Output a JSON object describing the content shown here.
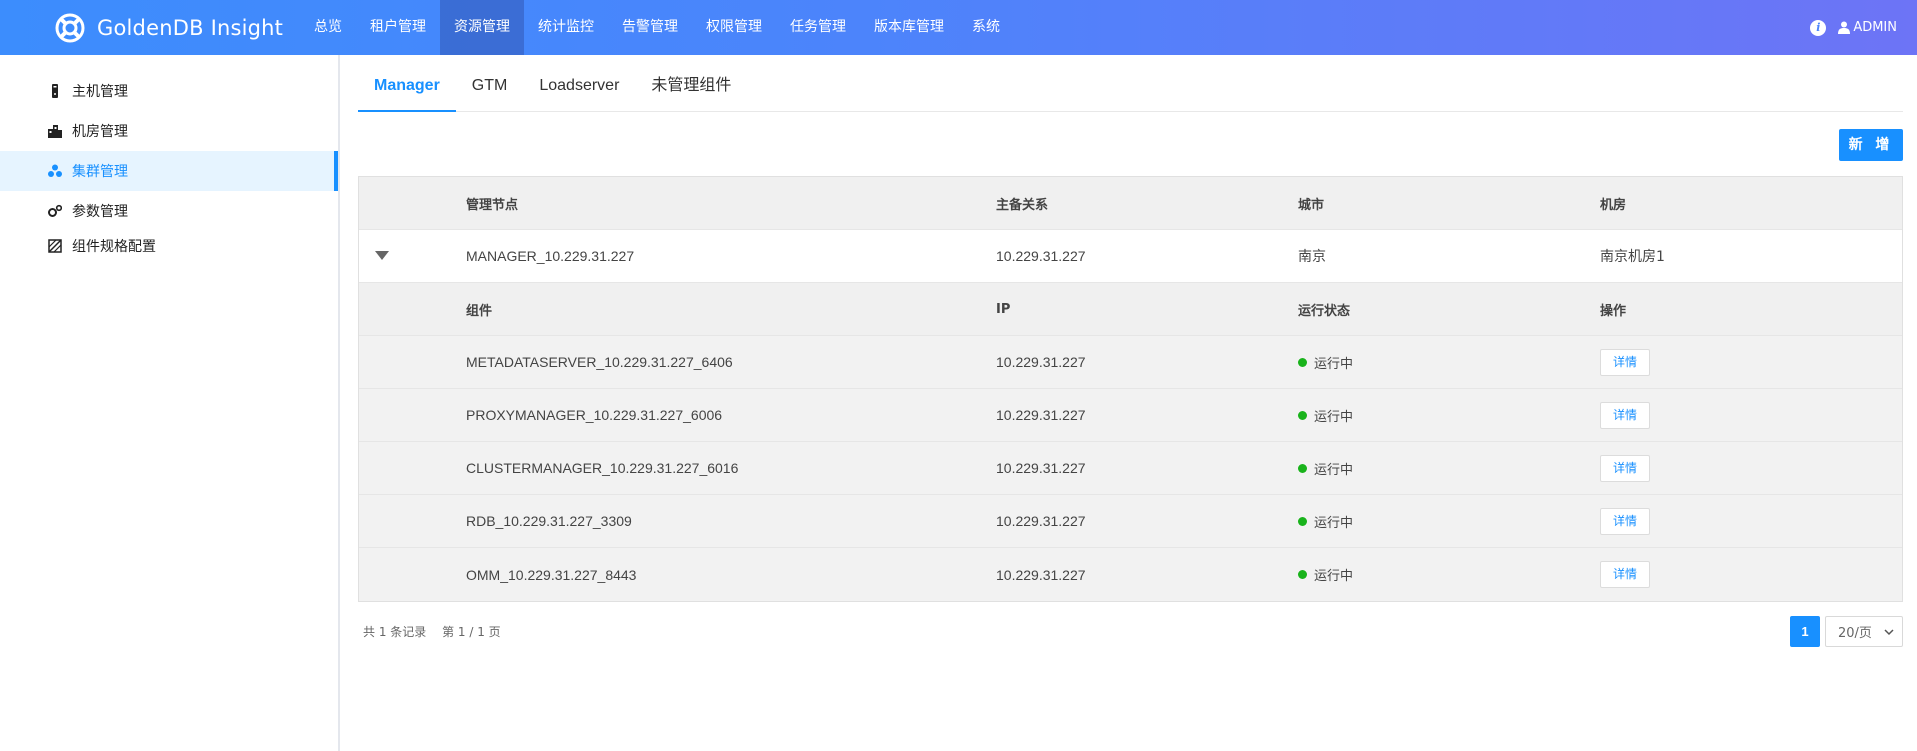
{
  "header": {
    "brand_name": "GoldenDB Insight",
    "nav": [
      {
        "label": "总览"
      },
      {
        "label": "租户管理"
      },
      {
        "label": "资源管理"
      },
      {
        "label": "统计监控"
      },
      {
        "label": "告警管理"
      },
      {
        "label": "权限管理"
      },
      {
        "label": "任务管理"
      },
      {
        "label": "版本库管理"
      },
      {
        "label": "系统"
      }
    ],
    "active_nav": "资源管理",
    "info_icon": "info-icon",
    "user_label": "ADMIN"
  },
  "sidebar": {
    "items": [
      {
        "label": "主机管理",
        "icon": "host-icon"
      },
      {
        "label": "机房管理",
        "icon": "building-icon"
      },
      {
        "label": "集群管理",
        "icon": "cluster-icon"
      },
      {
        "label": "参数管理",
        "icon": "gears-icon"
      },
      {
        "label": "组件规格配置",
        "icon": "spec-icon"
      }
    ],
    "active_item": "集群管理"
  },
  "tabs": [
    {
      "label": "Manager"
    },
    {
      "label": "GTM"
    },
    {
      "label": "Loadserver"
    },
    {
      "label": "未管理组件"
    }
  ],
  "active_tab": "Manager",
  "add_button_label": "新 增",
  "table": {
    "headers": [
      "管理节点",
      "主备关系",
      "城市",
      "机房"
    ],
    "parent_row": {
      "node": "MANAGER_10.229.31.227",
      "relation": "10.229.31.227",
      "city": "南京",
      "room": "南京机房1"
    },
    "sub_headers": [
      "组件",
      "IP",
      "运行状态",
      "操作"
    ],
    "components": [
      {
        "name": "METADATASERVER_10.229.31.227_6406",
        "ip": "10.229.31.227",
        "status": "运行中",
        "action": "详情"
      },
      {
        "name": "PROXYMANAGER_10.229.31.227_6006",
        "ip": "10.229.31.227",
        "status": "运行中",
        "action": "详情"
      },
      {
        "name": "CLUSTERMANAGER_10.229.31.227_6016",
        "ip": "10.229.31.227",
        "status": "运行中",
        "action": "详情"
      },
      {
        "name": "RDB_10.229.31.227_3309",
        "ip": "10.229.31.227",
        "status": "运行中",
        "action": "详情"
      },
      {
        "name": "OMM_10.229.31.227_8443",
        "ip": "10.229.31.227",
        "status": "运行中",
        "action": "详情"
      }
    ],
    "status_color": "#19b31b"
  },
  "footer": {
    "total_records": "共 1 条记录",
    "page_info": "第 1 / 1 页",
    "current_page": "1",
    "page_size": "20/页"
  },
  "colors": {
    "accent": "#1890ff",
    "header_gradient_start": "#3c8dfd",
    "header_gradient_end": "#6d74f6"
  }
}
